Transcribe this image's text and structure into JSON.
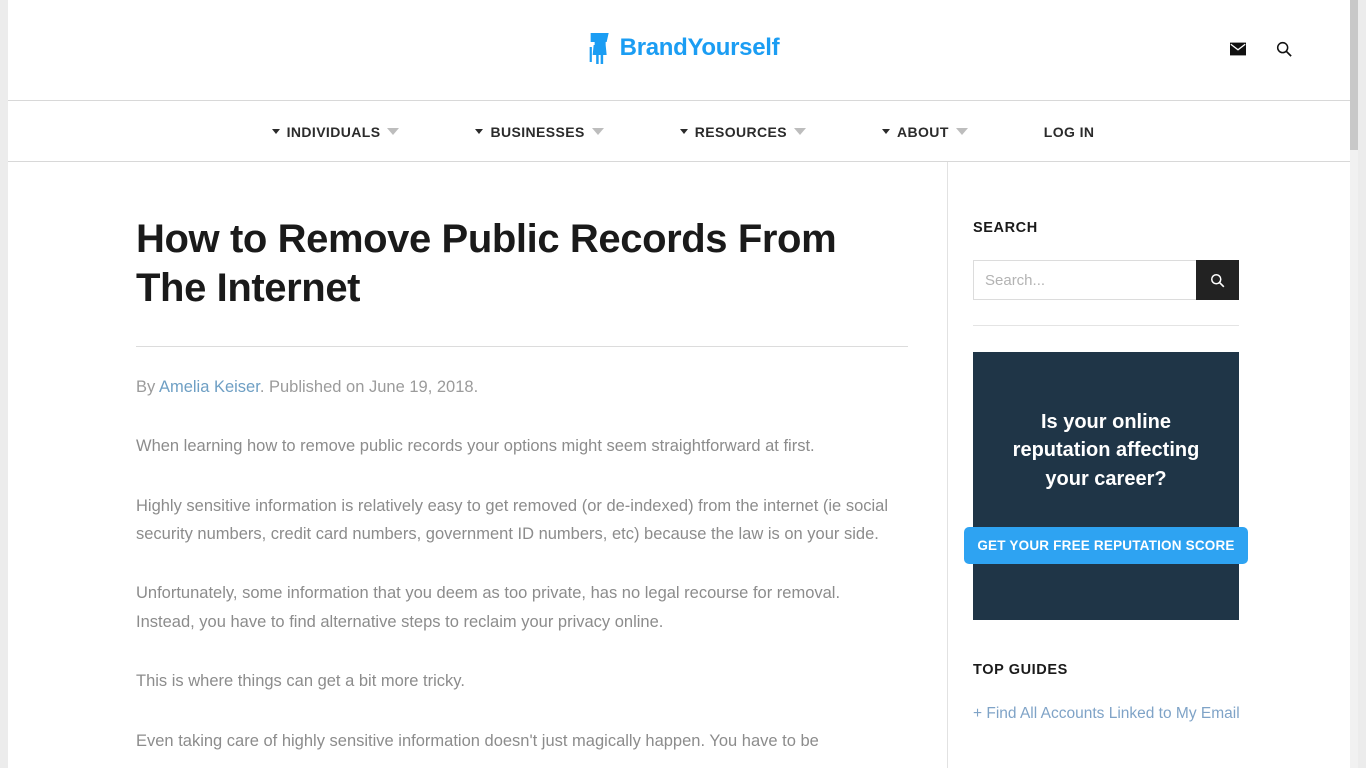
{
  "site": {
    "logo_text": "BrandYourself",
    "logo_color": "#1b9df3",
    "mail_icon": "mail-icon",
    "search_icon": "search-icon"
  },
  "nav": {
    "items": [
      {
        "label": "INDIVIDUALS",
        "has_dropdown": true
      },
      {
        "label": "BUSINESSES",
        "has_dropdown": true
      },
      {
        "label": "RESOURCES",
        "has_dropdown": true
      },
      {
        "label": "ABOUT",
        "has_dropdown": true
      },
      {
        "label": "LOG IN",
        "has_dropdown": false
      }
    ]
  },
  "article": {
    "title": "How to Remove Public Records From The Internet",
    "byline_prefix": "By ",
    "author": "Amelia Keiser",
    "byline_suffix": ". Published on June 19, 2018.",
    "paragraphs": [
      "When learning how to remove public records your options might seem straightforward at first.",
      "Highly sensitive information is relatively easy to get removed (or de-indexed) from the internet (ie social security numbers, credit card numbers, government ID numbers, etc) because the law is on your side.",
      "Unfortunately, some information that you deem as too private, has no legal recourse for removal. Instead, you have to find alternative steps to reclaim your privacy online.",
      "This is where things can get a bit more tricky.",
      "Even taking care of highly sensitive information doesn't just magically happen. You have to be"
    ]
  },
  "sidebar": {
    "search": {
      "title": "SEARCH",
      "placeholder": "Search...",
      "value": "",
      "submit_icon": "search-icon"
    },
    "promo": {
      "headline": "Is your online reputation affecting your career?",
      "cta_label": "GET YOUR FREE REPUTATION SCORE",
      "background_color": "#1f3547",
      "cta_color": "#2ea3f2"
    },
    "guides": {
      "title": "TOP GUIDES",
      "links": [
        "+ Find All Accounts Linked to My Email"
      ]
    }
  }
}
